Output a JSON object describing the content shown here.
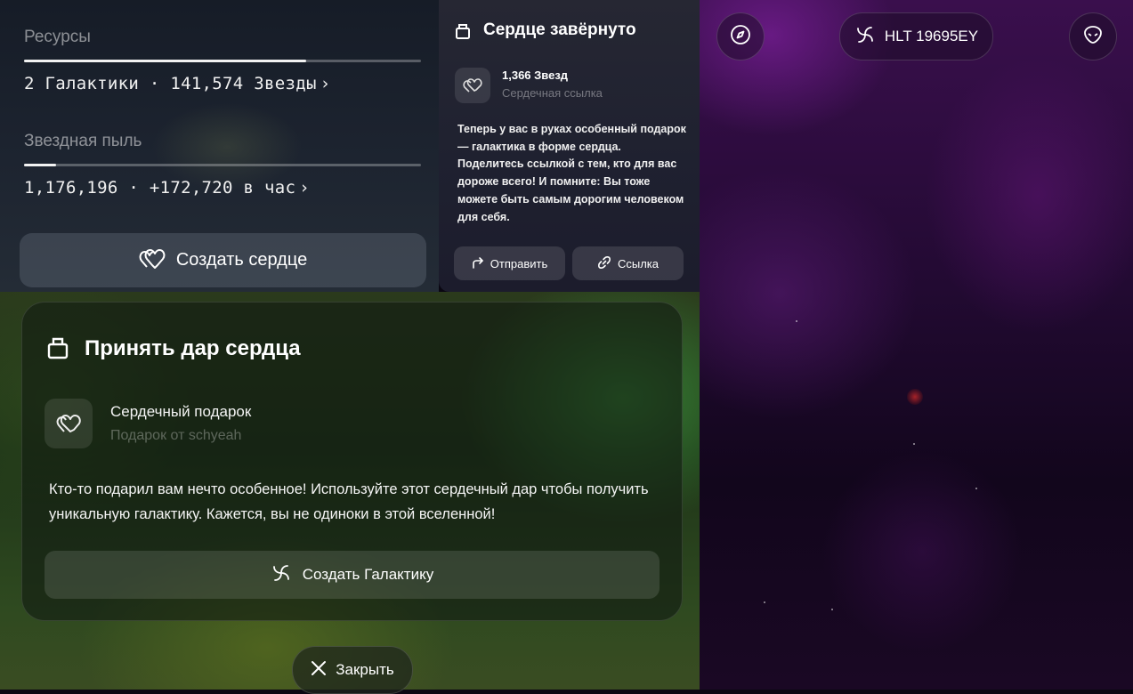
{
  "resources": {
    "galaxies_label": "Ресурсы",
    "galaxies_value": "2 Галактики · 141,574 Звезды",
    "galaxies_progress": 0.71,
    "dust_label": "Звездная пыль",
    "dust_value": "1,176,196 · +172,720 в час",
    "dust_progress": 0.08,
    "chevron": "›",
    "create_heart_label": "Создать сердце",
    "create_heart_icon": "heart-link-icon"
  },
  "wrapped_card": {
    "title": "Сердце завёрнуто",
    "title_icon": "gift-icon",
    "item_title": "1,366 Звезд",
    "item_subtitle": "Сердечная ссылка",
    "item_icon": "heart-link-icon",
    "description": "Теперь у вас в руках особенный подарок — галактика в форме сердца. Поделитесь ссылкой с тем, кто для вас дороже всего! И помните: Вы тоже можете быть самым дорогим человеком для себя.",
    "send_label": "Отправить",
    "link_label": "Ссылка"
  },
  "space_view": {
    "token_label": "HLT 19695EY",
    "left_icon": "compass-icon",
    "right_icon": "alien-icon",
    "token_icon": "galaxy-spiral-icon"
  },
  "gift_card": {
    "title": "Принять дар сердца",
    "title_icon": "gift-icon",
    "item_title": "Сердечный подарок",
    "item_subtitle": "Подарок от schyeah",
    "description": "Кто-то подарил вам нечто особенное! Используйте этот сердечный дар чтобы получить уникальную галактику. Кажется, вы не одиноки в этой вселенной!",
    "create_galaxy_label": "Создать Галактику",
    "close_label": "Закрыть"
  },
  "colors": {
    "space_purple": "#3a0f4d",
    "accent_white": "#ffffff",
    "muted_text": "#8a8a95"
  }
}
